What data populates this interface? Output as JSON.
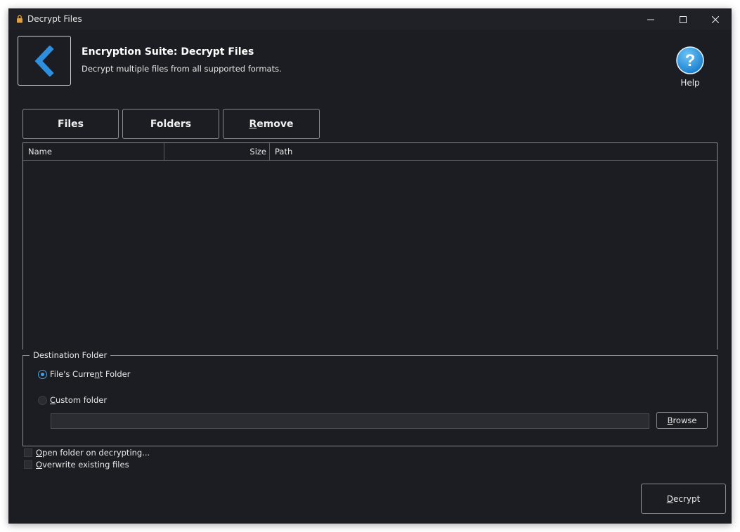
{
  "window": {
    "title": "Decrypt Files"
  },
  "header": {
    "title": "Encryption Suite: Decrypt Files",
    "subtitle": "Decrypt multiple files from all supported formats.",
    "help_label": "Help"
  },
  "toolbar": {
    "files_label": "Files",
    "folders_label": "Folders",
    "remove_first": "R",
    "remove_rest": "emove"
  },
  "file_list": {
    "columns": [
      "Name",
      "Size",
      "Path"
    ],
    "rows": []
  },
  "destination": {
    "legend": "Destination Folder",
    "current_folder": {
      "pre": "File's Curre",
      "ul": "n",
      "post": "t Folder",
      "selected": true
    },
    "custom_folder": {
      "ul": "C",
      "post": "ustom folder",
      "selected": false
    },
    "path_value": "",
    "browse": {
      "ul": "B",
      "post": "rowse"
    }
  },
  "options": {
    "open_folder": {
      "ul": "O",
      "post": "pen folder on decrypting...",
      "checked": false
    },
    "overwrite": {
      "ul": "O",
      "post": "verwrite existing files",
      "checked": false
    }
  },
  "actions": {
    "decrypt": {
      "ul": "D",
      "post": "ecrypt"
    }
  },
  "colors": {
    "accent": "#4aa3df",
    "background": "#1b1d22",
    "back_arrow": "#2e8fde",
    "help_circle": "#2b95e0"
  }
}
